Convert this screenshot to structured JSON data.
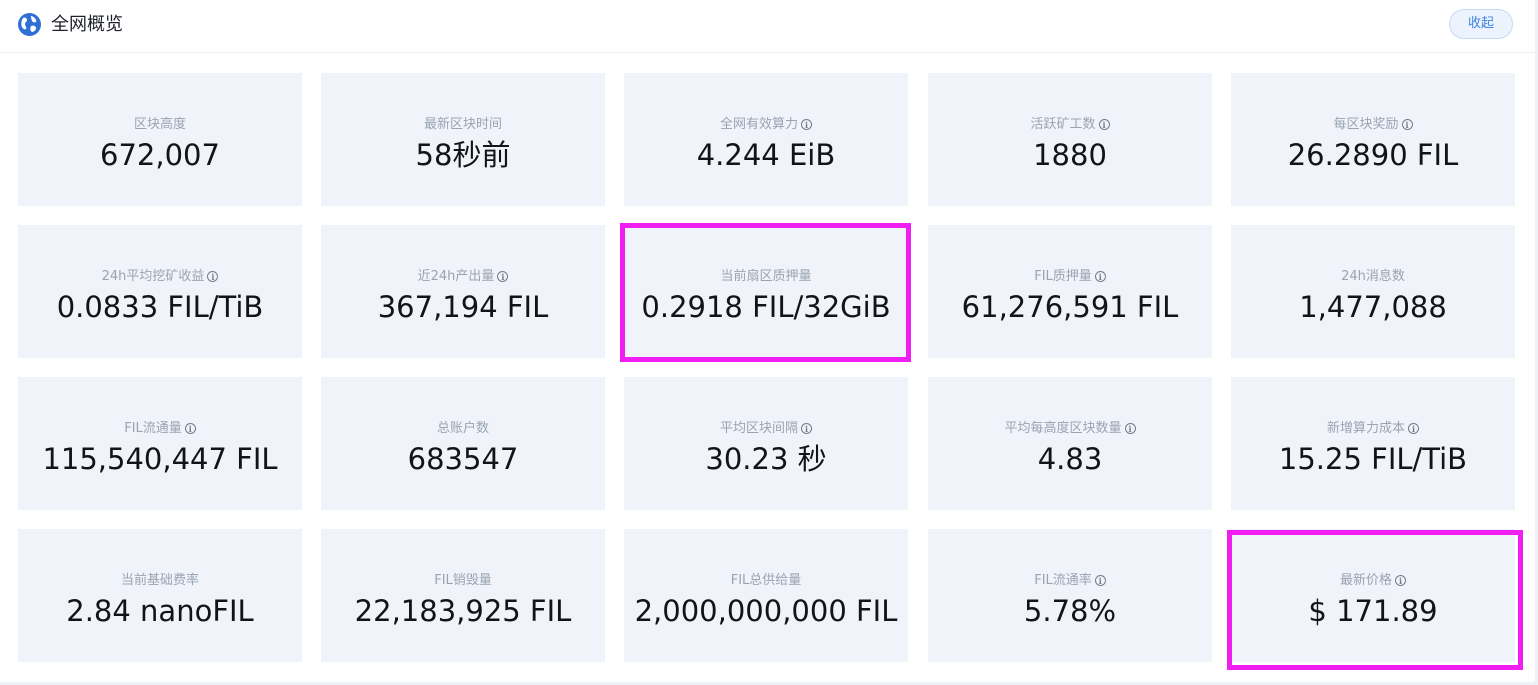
{
  "header": {
    "title": "全网概览",
    "collapse_label": "收起",
    "icon": "globe-icon"
  },
  "info_glyph": "i",
  "colors": {
    "card_bg": "#f0f4fa",
    "highlight": "#f01ef0",
    "accent": "#3f82e3"
  },
  "stats": [
    {
      "label": "区块高度",
      "value": "672,007",
      "info": false
    },
    {
      "label": "最新区块时间",
      "value": "58秒前",
      "info": false
    },
    {
      "label": "全网有效算力",
      "value": "4.244 EiB",
      "info": true
    },
    {
      "label": "活跃矿工数",
      "value": "1880",
      "info": true
    },
    {
      "label": "每区块奖励",
      "value": "26.2890 FIL",
      "info": true
    },
    {
      "label": "24h平均挖矿收益",
      "value": "0.0833 FIL/TiB",
      "info": true
    },
    {
      "label": "近24h产出量",
      "value": "367,194 FIL",
      "info": true
    },
    {
      "label": "当前扇区质押量",
      "value": "0.2918 FIL/32GiB",
      "info": false,
      "highlighted": true
    },
    {
      "label": "FIL质押量",
      "value": "61,276,591 FIL",
      "info": true
    },
    {
      "label": "24h消息数",
      "value": "1,477,088",
      "info": false
    },
    {
      "label": "FIL流通量",
      "value": "115,540,447 FIL",
      "info": true
    },
    {
      "label": "总账户数",
      "value": "683547",
      "info": false
    },
    {
      "label": "平均区块间隔",
      "value": "30.23 秒",
      "info": true
    },
    {
      "label": "平均每高度区块数量",
      "value": "4.83",
      "info": true
    },
    {
      "label": "新增算力成本",
      "value": "15.25 FIL/TiB",
      "info": true
    },
    {
      "label": "当前基础费率",
      "value": "2.84 nanoFIL",
      "info": false
    },
    {
      "label": "FIL销毁量",
      "value": "22,183,925 FIL",
      "info": false
    },
    {
      "label": "FIL总供给量",
      "value": "2,000,000,000 FIL",
      "info": false
    },
    {
      "label": "FIL流通率",
      "value": "5.78%",
      "info": true
    },
    {
      "label": "最新价格",
      "value": "$ 171.89",
      "info": true,
      "highlighted": true
    }
  ]
}
